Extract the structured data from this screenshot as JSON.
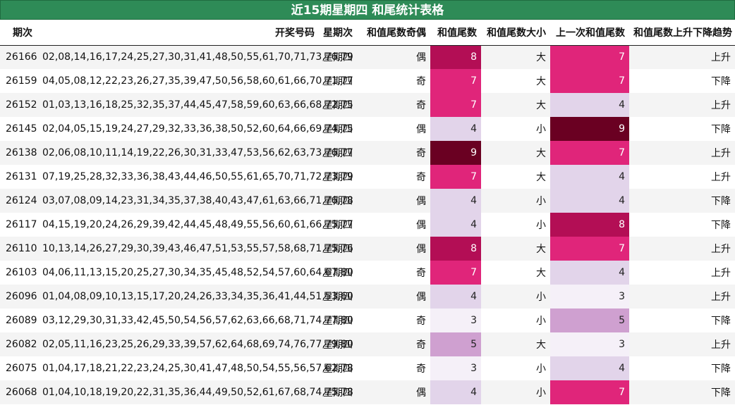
{
  "title": "近15期星期四 和尾统计表格",
  "headers": {
    "issue": "期次",
    "numbers": "开奖号码",
    "weekday": "星期次",
    "odd_even": "和值尾数奇偶",
    "tail": "和值尾数",
    "big_small": "和值尾数大小",
    "prev_tail": "上一次和值尾数",
    "trend": "和值尾数上升下降趋势"
  },
  "heat_colors": {
    "3": "#f5f0f8",
    "4": "#e2d4ea",
    "5": "#cfa0d0",
    "7": "#e0257a",
    "8": "#b30e55",
    "9": "#6a0022"
  },
  "rows": [
    {
      "issue": "26166",
      "numbers": "02,08,14,16,17,24,25,27,30,31,41,48,50,55,61,70,71,73,76,79",
      "weekday": "星期四",
      "odd_even": "偶",
      "tail": "8",
      "big_small": "大",
      "prev_tail": "7",
      "trend": "上升"
    },
    {
      "issue": "26159",
      "numbers": "04,05,08,12,22,23,26,27,35,39,47,50,56,58,60,61,66,70,71,77",
      "weekday": "星期四",
      "odd_even": "奇",
      "tail": "7",
      "big_small": "大",
      "prev_tail": "7",
      "trend": "下降"
    },
    {
      "issue": "26152",
      "numbers": "01,03,13,16,18,25,32,35,37,44,45,47,58,59,60,63,66,68,72,75",
      "weekday": "星期四",
      "odd_even": "奇",
      "tail": "7",
      "big_small": "大",
      "prev_tail": "4",
      "trend": "上升"
    },
    {
      "issue": "26145",
      "numbers": "02,04,05,15,19,24,27,29,32,33,36,38,50,52,60,64,66,69,74,75",
      "weekday": "星期四",
      "odd_even": "偶",
      "tail": "4",
      "big_small": "小",
      "prev_tail": "9",
      "trend": "下降"
    },
    {
      "issue": "26138",
      "numbers": "02,06,08,10,11,14,19,22,26,30,31,33,47,53,56,62,63,73,76,77",
      "weekday": "星期四",
      "odd_even": "奇",
      "tail": "9",
      "big_small": "大",
      "prev_tail": "7",
      "trend": "上升"
    },
    {
      "issue": "26131",
      "numbers": "07,19,25,28,32,33,36,38,43,44,46,50,55,61,65,70,71,72,73,79",
      "weekday": "星期四",
      "odd_even": "奇",
      "tail": "7",
      "big_small": "大",
      "prev_tail": "4",
      "trend": "上升"
    },
    {
      "issue": "26124",
      "numbers": "03,07,08,09,14,23,31,34,35,37,38,40,43,47,61,63,66,71,76,78",
      "weekday": "星期四",
      "odd_even": "偶",
      "tail": "4",
      "big_small": "小",
      "prev_tail": "4",
      "trend": "下降"
    },
    {
      "issue": "26117",
      "numbers": "04,15,19,20,24,26,29,39,42,44,45,48,49,55,56,60,61,66,75,77",
      "weekday": "星期四",
      "odd_even": "偶",
      "tail": "4",
      "big_small": "小",
      "prev_tail": "8",
      "trend": "下降"
    },
    {
      "issue": "26110",
      "numbers": "10,13,14,26,27,29,30,39,43,46,47,51,53,55,57,58,68,71,75,76",
      "weekday": "星期四",
      "odd_even": "偶",
      "tail": "8",
      "big_small": "大",
      "prev_tail": "7",
      "trend": "上升"
    },
    {
      "issue": "26103",
      "numbers": "04,06,11,13,15,20,25,27,30,34,35,45,48,52,54,57,60,64,67,80",
      "weekday": "星期四",
      "odd_even": "奇",
      "tail": "7",
      "big_small": "大",
      "prev_tail": "4",
      "trend": "上升"
    },
    {
      "issue": "26096",
      "numbers": "01,04,08,09,10,13,15,17,20,24,26,33,34,35,36,41,44,51,53,60",
      "weekday": "星期四",
      "odd_even": "偶",
      "tail": "4",
      "big_small": "小",
      "prev_tail": "3",
      "trend": "上升"
    },
    {
      "issue": "26089",
      "numbers": "03,12,29,30,31,33,42,45,50,54,56,57,62,63,66,68,71,74,77,80",
      "weekday": "星期四",
      "odd_even": "奇",
      "tail": "3",
      "big_small": "小",
      "prev_tail": "5",
      "trend": "下降"
    },
    {
      "issue": "26082",
      "numbers": "02,05,11,16,23,25,26,29,33,39,57,62,64,68,69,74,76,77,79,80",
      "weekday": "星期四",
      "odd_even": "奇",
      "tail": "5",
      "big_small": "大",
      "prev_tail": "3",
      "trend": "上升"
    },
    {
      "issue": "26075",
      "numbers": "01,04,17,18,21,22,23,24,25,30,41,47,48,50,54,55,56,57,62,78",
      "weekday": "星期四",
      "odd_even": "奇",
      "tail": "3",
      "big_small": "小",
      "prev_tail": "4",
      "trend": "下降"
    },
    {
      "issue": "26068",
      "numbers": "01,04,10,18,19,20,22,31,35,36,44,49,50,52,61,67,68,74,75,78",
      "weekday": "星期四",
      "odd_even": "偶",
      "tail": "4",
      "big_small": "小",
      "prev_tail": "7",
      "trend": "下降"
    }
  ]
}
